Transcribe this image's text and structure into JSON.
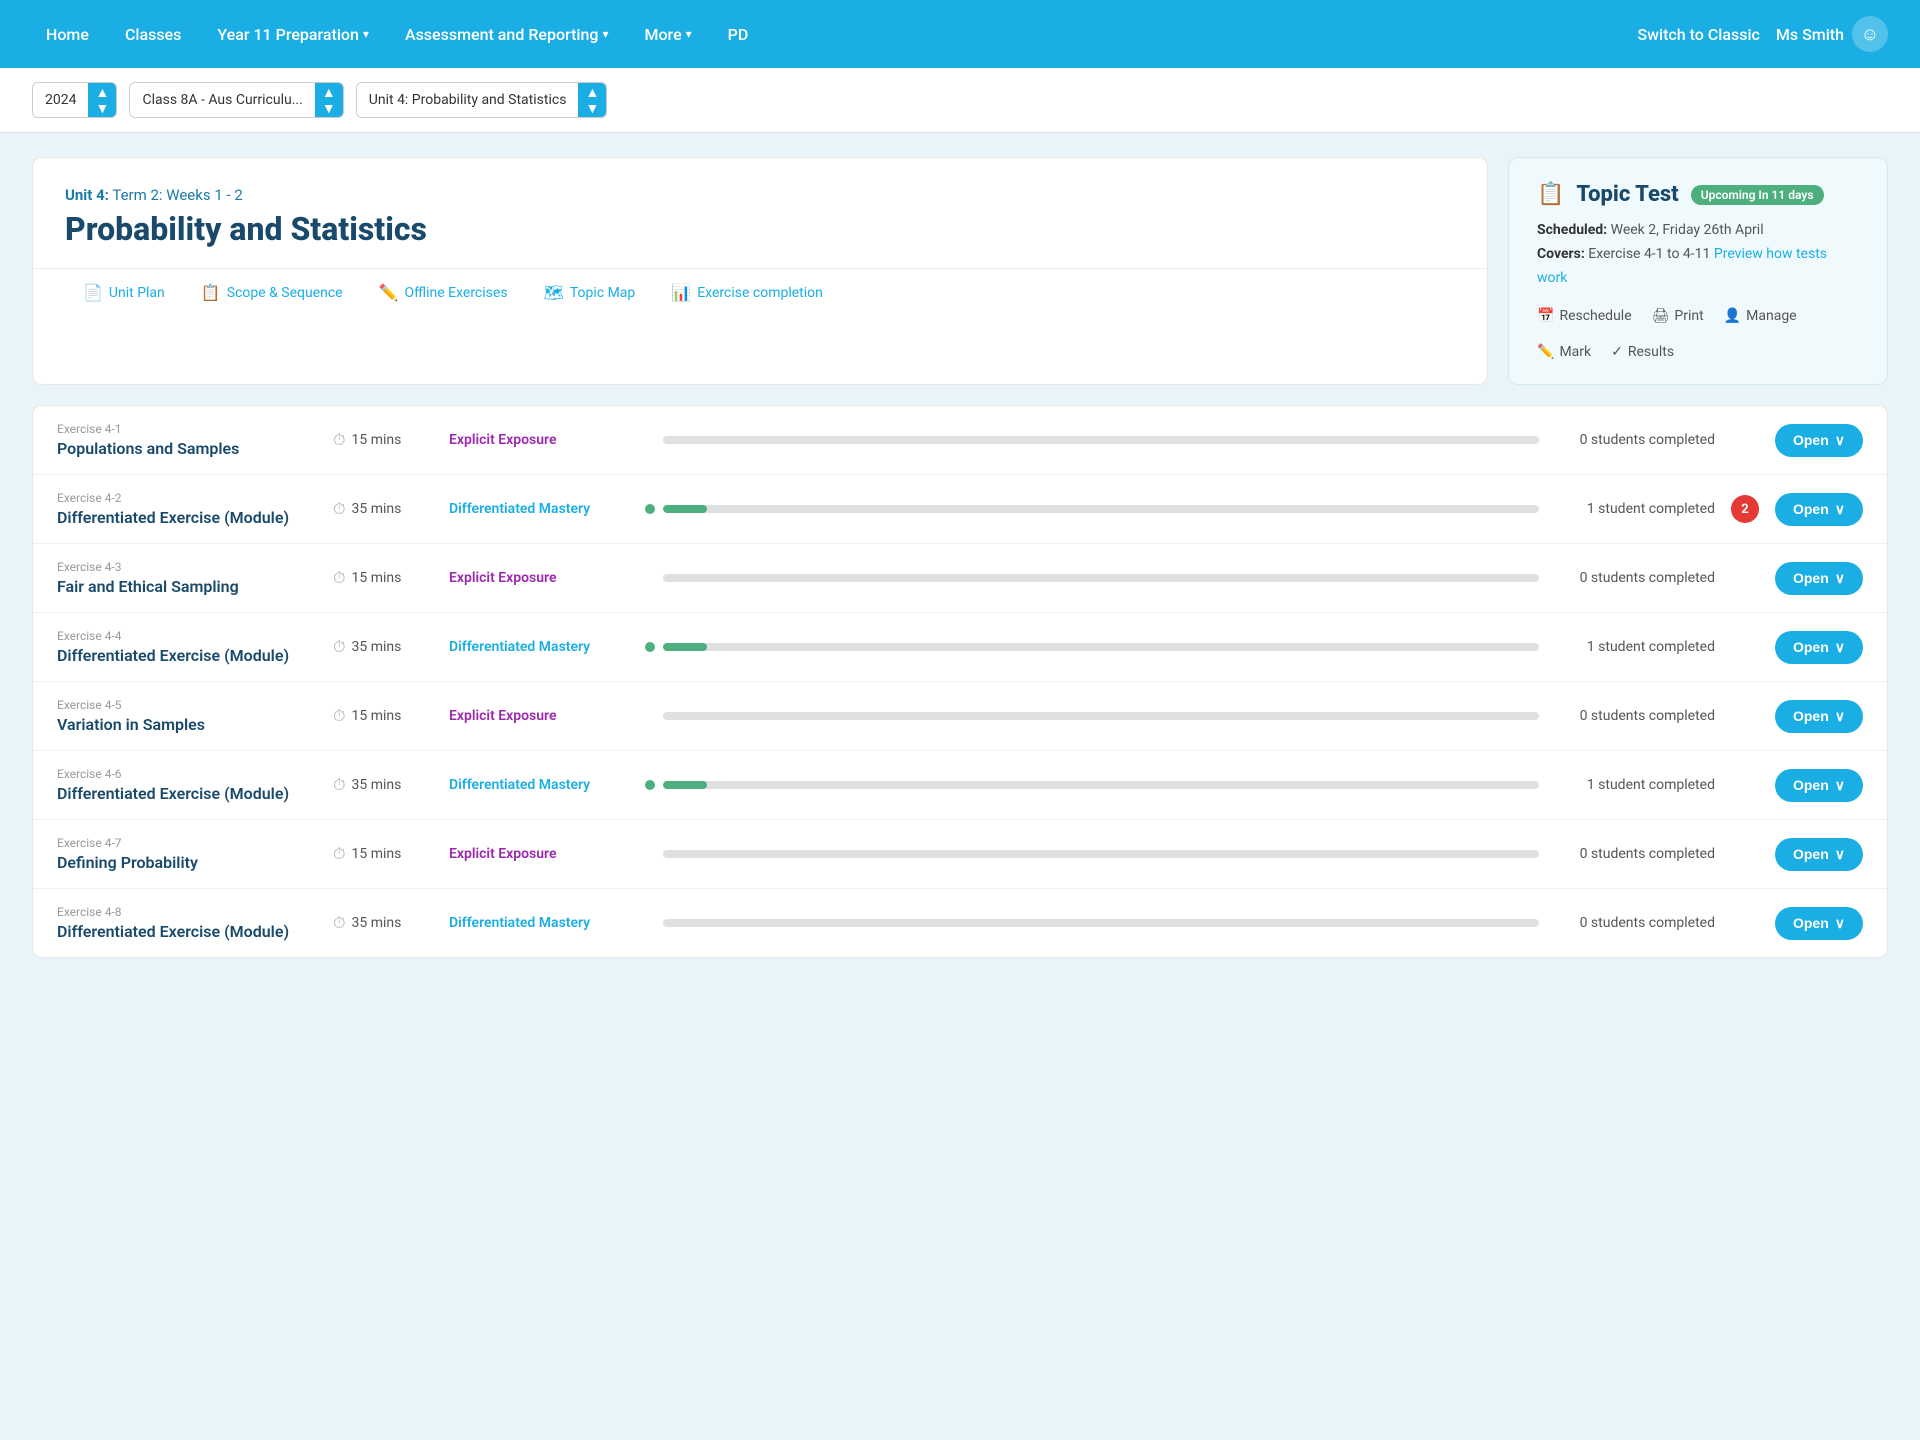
{
  "nav": {
    "items": [
      {
        "id": "home",
        "label": "Home"
      },
      {
        "id": "classes",
        "label": "Classes"
      },
      {
        "id": "year11",
        "label": "Year 11 Preparation",
        "hasChevron": true
      },
      {
        "id": "assessment",
        "label": "Assessment and Reporting",
        "hasChevron": true
      },
      {
        "id": "more",
        "label": "More",
        "hasChevron": true
      },
      {
        "id": "pd",
        "label": "PD"
      }
    ],
    "switch_classic": "Switch to Classic",
    "user_name": "Ms Smith",
    "user_icon": "☺"
  },
  "toolbar": {
    "year": "2024",
    "class": "Class 8A - Aus Curriculu...",
    "unit": "Unit 4: Probability and Statistics"
  },
  "unit": {
    "term_label": "Unit 4:",
    "term_value": "Term 2: Weeks 1 - 2",
    "title": "Probability and Statistics",
    "tabs": [
      {
        "id": "unit-plan",
        "label": "Unit Plan",
        "icon": "📄"
      },
      {
        "id": "scope-sequence",
        "label": "Scope & Sequence",
        "icon": "📋"
      },
      {
        "id": "offline-exercises",
        "label": "Offline Exercises",
        "icon": "✏️"
      },
      {
        "id": "topic-map",
        "label": "Topic Map",
        "icon": "🗺"
      },
      {
        "id": "exercise-completion",
        "label": "Exercise completion",
        "icon": "📊"
      }
    ]
  },
  "topic_test": {
    "icon": "📋",
    "title": "Topic Test",
    "badge": "Upcoming In 11 days",
    "scheduled_label": "Scheduled:",
    "scheduled_value": "Week 2, Friday 26th April",
    "covers_label": "Covers:",
    "covers_value": "Exercise 4-1 to 4-11",
    "preview_link": "Preview how tests work",
    "actions": [
      {
        "id": "reschedule",
        "label": "Reschedule",
        "icon": "📅"
      },
      {
        "id": "print",
        "label": "Print",
        "icon": "🖨"
      },
      {
        "id": "manage",
        "label": "Manage",
        "icon": "👤"
      },
      {
        "id": "mark",
        "label": "Mark",
        "icon": "✏️"
      },
      {
        "id": "results",
        "label": "Results",
        "icon": "✓"
      }
    ]
  },
  "exercises": [
    {
      "num": "Exercise 4-1",
      "name": "Populations and Samples",
      "time": "15 mins",
      "type": "Explicit Exposure",
      "type_class": "type-explicit",
      "progress": 0,
      "has_dot": false,
      "completed": "0 students completed",
      "badge": null
    },
    {
      "num": "Exercise 4-2",
      "name": "Differentiated Exercise (Module)",
      "time": "35 mins",
      "type": "Differentiated Mastery",
      "type_class": "type-mastery",
      "progress": 5,
      "has_dot": true,
      "completed": "1 student completed",
      "badge": "2"
    },
    {
      "num": "Exercise 4-3",
      "name": "Fair and Ethical Sampling",
      "time": "15 mins",
      "type": "Explicit Exposure",
      "type_class": "type-explicit",
      "progress": 0,
      "has_dot": false,
      "completed": "0 students completed",
      "badge": null
    },
    {
      "num": "Exercise 4-4",
      "name": "Differentiated Exercise (Module)",
      "time": "35 mins",
      "type": "Differentiated Mastery",
      "type_class": "type-mastery",
      "progress": 5,
      "has_dot": true,
      "completed": "1 student completed",
      "badge": null
    },
    {
      "num": "Exercise 4-5",
      "name": "Variation in Samples",
      "time": "15 mins",
      "type": "Explicit Exposure",
      "type_class": "type-explicit",
      "progress": 0,
      "has_dot": false,
      "completed": "0 students completed",
      "badge": null
    },
    {
      "num": "Exercise 4-6",
      "name": "Differentiated Exercise (Module)",
      "time": "35 mins",
      "type": "Differentiated Mastery",
      "type_class": "type-mastery",
      "progress": 5,
      "has_dot": true,
      "completed": "1 student completed",
      "badge": null
    },
    {
      "num": "Exercise 4-7",
      "name": "Defining Probability",
      "time": "15 mins",
      "type": "Explicit Exposure",
      "type_class": "type-explicit",
      "progress": 0,
      "has_dot": false,
      "completed": "0 students completed",
      "badge": null
    },
    {
      "num": "Exercise 4-8",
      "name": "Differentiated Exercise (Module)",
      "time": "35 mins",
      "type": "Differentiated Mastery",
      "type_class": "type-mastery",
      "progress": 0,
      "has_dot": false,
      "completed": "0 students completed",
      "badge": null
    }
  ],
  "open_btn_label": "Open",
  "chevron_down": "∨"
}
